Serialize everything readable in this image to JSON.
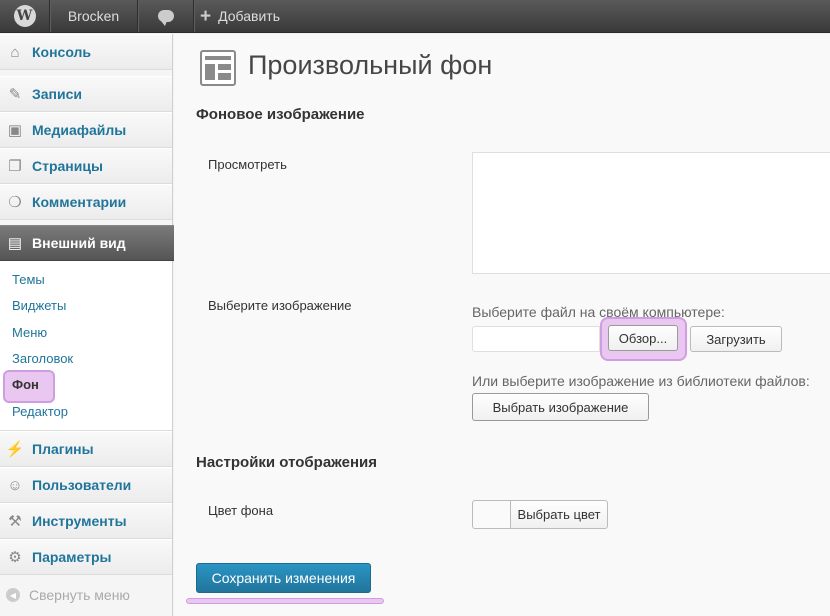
{
  "adminbar": {
    "logo_glyph": "W",
    "site_name": "Brocken",
    "new_label": "Добавить"
  },
  "sidebar": {
    "items": [
      {
        "label": "Консоль",
        "icon": "home-icon"
      },
      {
        "label": "Записи",
        "icon": "pin-icon"
      },
      {
        "label": "Медиафайлы",
        "icon": "media-icon"
      },
      {
        "label": "Страницы",
        "icon": "pages-icon"
      },
      {
        "label": "Комментарии",
        "icon": "comments-icon"
      },
      {
        "label": "Внешний вид",
        "icon": "appearance-icon"
      },
      {
        "label": "Плагины",
        "icon": "plugins-icon"
      },
      {
        "label": "Пользователи",
        "icon": "users-icon"
      },
      {
        "label": "Инструменты",
        "icon": "tools-icon"
      },
      {
        "label": "Параметры",
        "icon": "settings-icon"
      }
    ],
    "submenu": [
      "Темы",
      "Виджеты",
      "Меню",
      "Заголовок",
      "Фон",
      "Редактор"
    ],
    "collapse_label": "Свернуть меню"
  },
  "main": {
    "title": "Произвольный фон",
    "bg_image_section": "Фоновое изображение",
    "preview_label": "Просмотреть",
    "choose_image_label": "Выберите изображение",
    "choose_file_hint": "Выберите файл на своём компьютере:",
    "browse_button": "Обзор...",
    "upload_button": "Загрузить",
    "library_hint": "Или выберите изображение из библиотеки файлов:",
    "choose_image_button": "Выбрать изображение",
    "display_section": "Настройки отображения",
    "bg_color_label": "Цвет фона",
    "choose_color_button": "Выбрать цвет",
    "save_button": "Сохранить изменения"
  },
  "colors": {
    "link": "#21759b",
    "highlight": "#e9c7f1",
    "primary_button": "#21759b"
  }
}
